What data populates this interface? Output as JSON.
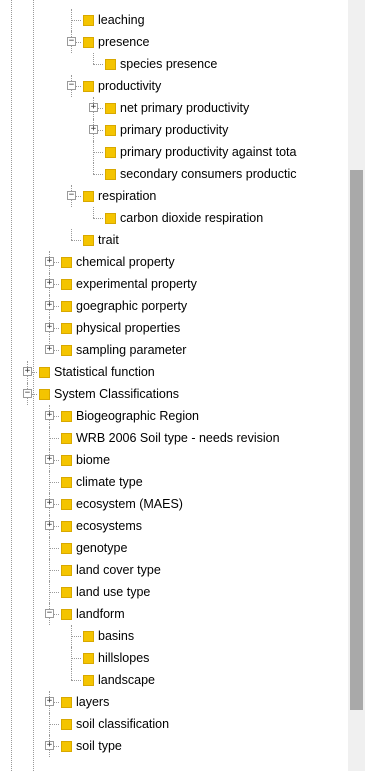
{
  "tree": {
    "rows": [
      {
        "label": "leaching",
        "level": 3,
        "exp": "",
        "last": false
      },
      {
        "label": "presence",
        "level": 3,
        "exp": "-",
        "last": false
      },
      {
        "label": "species presence",
        "level": 4,
        "exp": "",
        "last": true
      },
      {
        "label": "productivity",
        "level": 3,
        "exp": "-",
        "last": false
      },
      {
        "label": "net primary productivity",
        "level": 4,
        "exp": "+",
        "last": false
      },
      {
        "label": "primary productivity",
        "level": 4,
        "exp": "+",
        "last": false
      },
      {
        "label": "primary productivity against tota",
        "level": 4,
        "exp": "",
        "last": false
      },
      {
        "label": "secondary consumers productic",
        "level": 4,
        "exp": "",
        "last": true
      },
      {
        "label": "respiration",
        "level": 3,
        "exp": "-",
        "last": false
      },
      {
        "label": "carbon dioxide respiration",
        "level": 4,
        "exp": "",
        "last": true
      },
      {
        "label": "trait",
        "level": 3,
        "exp": "",
        "last": true
      },
      {
        "label": "chemical property",
        "level": 2,
        "exp": "+",
        "last": false
      },
      {
        "label": "experimental property",
        "level": 2,
        "exp": "+",
        "last": false
      },
      {
        "label": "goegraphic porperty",
        "level": 2,
        "exp": "+",
        "last": false
      },
      {
        "label": "physical properties",
        "level": 2,
        "exp": "+",
        "last": false
      },
      {
        "label": "sampling parameter",
        "level": 2,
        "exp": "+",
        "last": true
      },
      {
        "label": "Statistical function",
        "level": 1,
        "exp": "+",
        "last": false
      },
      {
        "label": "System Classifications",
        "level": 1,
        "exp": "-",
        "last": false
      },
      {
        "label": "Biogeographic Region",
        "level": 2,
        "exp": "+",
        "last": false
      },
      {
        "label": "WRB 2006 Soil type - needs revision",
        "level": 2,
        "exp": "",
        "last": false
      },
      {
        "label": "biome",
        "level": 2,
        "exp": "+",
        "last": false
      },
      {
        "label": "climate type",
        "level": 2,
        "exp": "",
        "last": false
      },
      {
        "label": "ecosystem (MAES)",
        "level": 2,
        "exp": "+",
        "last": false
      },
      {
        "label": "ecosystems",
        "level": 2,
        "exp": "+",
        "last": false
      },
      {
        "label": "genotype",
        "level": 2,
        "exp": "",
        "last": false
      },
      {
        "label": "land cover type",
        "level": 2,
        "exp": "",
        "last": false
      },
      {
        "label": "land use type",
        "level": 2,
        "exp": "",
        "last": false
      },
      {
        "label": "landform",
        "level": 2,
        "exp": "-",
        "last": false
      },
      {
        "label": "basins",
        "level": 3,
        "exp": "",
        "last": false
      },
      {
        "label": "hillslopes",
        "level": 3,
        "exp": "",
        "last": false
      },
      {
        "label": "landscape",
        "level": 3,
        "exp": "",
        "last": true
      },
      {
        "label": "layers",
        "level": 2,
        "exp": "+",
        "last": false
      },
      {
        "label": "soil classification",
        "level": 2,
        "exp": "",
        "last": false
      },
      {
        "label": "soil type",
        "level": 2,
        "exp": "+",
        "last": false
      }
    ]
  },
  "scrollbar": {
    "thumb_start": 0.22,
    "thumb_end": 0.92
  },
  "colors": {
    "folder": "#f4c400",
    "connector": "#9a9a9a",
    "scroll_track": "#f0f0f0",
    "scroll_thumb": "#a9a9a9"
  }
}
